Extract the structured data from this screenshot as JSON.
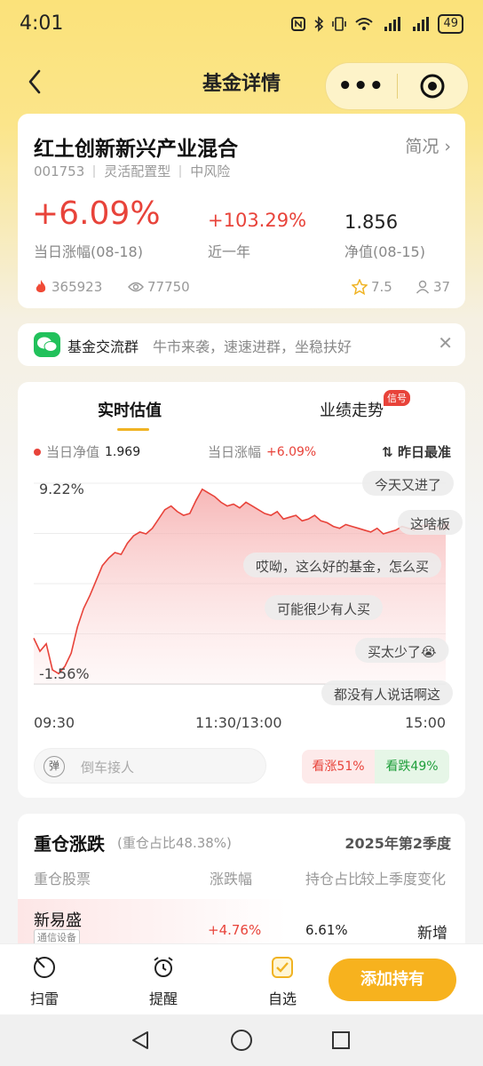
{
  "status_bar": {
    "time": "4:01",
    "icons": [
      "nfc-icon",
      "bluetooth-icon",
      "vibrate-icon",
      "wifi-icon",
      "signal-4g-icon",
      "signal-4g-icon"
    ],
    "battery": "49"
  },
  "navbar": {
    "title": "基金详情"
  },
  "fund": {
    "name": "红土创新新兴产业混合",
    "brief_label": "简况",
    "code": "001753",
    "type": "灵活配置型",
    "risk": "中风险",
    "daily_change": "+6.09%",
    "daily_change_label": "当日涨幅(08-18)",
    "year_change": "+103.29%",
    "year_change_label": "近一年",
    "nav": "1.856",
    "nav_label": "净值(08-15)",
    "heat": "365923",
    "views": "77750",
    "rating": "7.5",
    "followers": "37",
    "up_color": "#e8433a",
    "down_color": "#1e9e3a"
  },
  "group_banner": {
    "title": "基金交流群",
    "subtitle": "牛市来袭，速速进群，坐稳扶好"
  },
  "chart_section": {
    "tab_realtime": "实时估值",
    "tab_performance": "业绩走势",
    "signal_badge": "信号",
    "legend_nav_label": "当日净值",
    "legend_nav_value": "1.969",
    "legend_change_label": "当日涨幅",
    "legend_change_value": "+6.09%",
    "sort_label": "昨日最准",
    "comment_placeholder": "倒车接人",
    "danmaku_badge": "弹",
    "bull_label": "看涨51%",
    "bear_label": "看跌49%",
    "bullets": [
      "今天又进了",
      "这啥板",
      "哎呦，这么好的基金，怎么买",
      "可能很少有人买",
      "买太少了😭",
      "都没有人说话啊这"
    ]
  },
  "chart_data": {
    "type": "area",
    "x_ticks": [
      "09:30",
      "11:30/13:00",
      "15:00"
    ],
    "y_tick_labels": [
      "9.22%",
      "-1.56%"
    ],
    "ylim": [
      -1.56,
      9.22
    ],
    "series": [
      {
        "values": [
          0.9,
          0.2,
          0.6,
          -0.8,
          -1.0,
          -0.6,
          0.1,
          1.5,
          2.5,
          3.2,
          4.0,
          4.8,
          5.2,
          5.5,
          5.4,
          6.0,
          6.4,
          6.6,
          6.5,
          6.8,
          7.3,
          7.8,
          8.0,
          7.7,
          7.5,
          7.6,
          8.3,
          8.9,
          8.7,
          8.5,
          8.2,
          8.0,
          8.1,
          7.9,
          8.2,
          8.0,
          7.8,
          7.6,
          7.5,
          7.7,
          7.3,
          7.4,
          7.5,
          7.2,
          7.3,
          7.5,
          7.2,
          7.1,
          6.9,
          6.8,
          7.0,
          6.9,
          6.8,
          6.7,
          6.6,
          6.8,
          6.5,
          6.6,
          6.7,
          6.9,
          6.8,
          6.7,
          6.9,
          7.0,
          6.9,
          6.8,
          6.9
        ]
      }
    ],
    "grid": true
  },
  "holdings": {
    "title": "重仓涨跌",
    "ratio": "(重仓占比48.38%)",
    "quarter": "2025年第2季度",
    "columns": [
      "重仓股票",
      "涨跌幅",
      "持仓占比",
      "较上季度变化"
    ],
    "rows": [
      {
        "name": "新易盛",
        "tag": "通信设备",
        "change": "+4.76%",
        "weight": "6.61%",
        "delta": "新增"
      }
    ]
  },
  "bottom_bar": {
    "items": [
      "扫雷",
      "提醒",
      "自选"
    ],
    "add_button": "添加持有"
  }
}
